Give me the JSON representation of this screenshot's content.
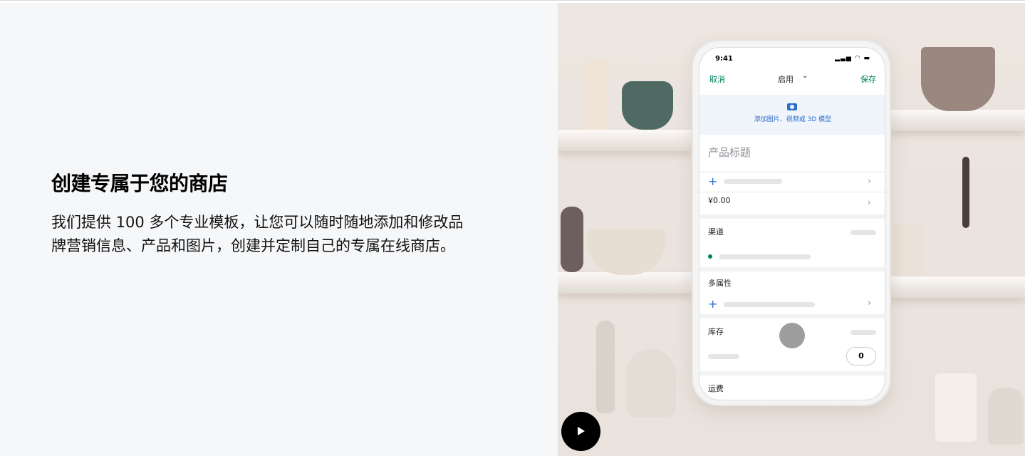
{
  "hero": {
    "headline": "创建专属于您的商店",
    "body": "我们提供 100 多个专业模板，让您可以随时随地添加和修改品牌营销信息、产品和图片，创建并定制自己的专属在线商店。"
  },
  "phone": {
    "status_time": "9:41",
    "nav": {
      "cancel": "取消",
      "title": "启用",
      "save": "保存"
    },
    "media_label": "添加图片、视频或 3D 模型",
    "product_title_placeholder": "产品标题",
    "price": "¥0.00",
    "channels_label": "渠道",
    "variants_label": "多属性",
    "inventory_label": "库存",
    "inventory_qty": "0",
    "shipping_label": "运费"
  },
  "icons": {
    "camera": "camera-icon",
    "plus": "plus-icon",
    "chevron_right": "chevron-right-icon",
    "chevron_down": "chevron-down-icon",
    "play": "play-icon"
  },
  "colors": {
    "accent_green": "#008060",
    "accent_blue": "#2c6ecb",
    "left_bg": "#f6f7f9",
    "play_button": "#000000"
  }
}
